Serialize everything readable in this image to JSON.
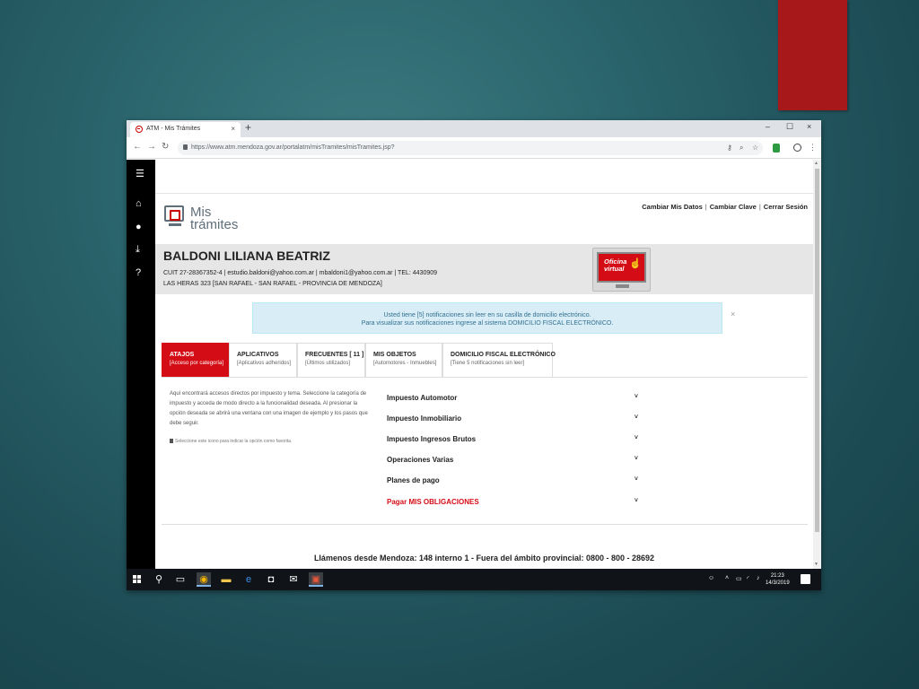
{
  "browser": {
    "tab_title": "ATM - Mis Trámites",
    "tab_close": "×",
    "new_tab": "+",
    "url": "https://www.atm.mendoza.gov.ar/portalatm/misTramites/misTramites.jsp?",
    "controls": {
      "minimize": "–",
      "maximize": "☐",
      "close": "×"
    },
    "nav": {
      "back": "←",
      "forward": "→",
      "reload": "↻"
    }
  },
  "logo": {
    "line1": "Mis",
    "line2": "trámites"
  },
  "top_links": [
    "Cambiar Mis Datos",
    "Cambiar Clave",
    "Cerrar Sesión"
  ],
  "top_links_sep": "|",
  "user": {
    "name": "BALDONI LILIANA BEATRIZ",
    "line1": "CUIT 27-28367352-4 | estudio.baldoni@yahoo.com.ar | mbaldoni1@yahoo.com.ar | TEL: 4430909",
    "line2": "LAS HERAS 323 [SAN RAFAEL - SAN RAFAEL - PROVINCIA DE MENDOZA]"
  },
  "oficina": {
    "line1": "Oficina",
    "line2": "virtual"
  },
  "notice": {
    "line1": "Usted tiene [5] notificaciones sin leer en su casilla de domicilio electrónico.",
    "line2": "Para visualizar sus notificaciones ingrese al sistema DOMICILIO FISCAL ELECTRÓNICO.",
    "close": "×"
  },
  "tabs": [
    {
      "title": "ATAJOS",
      "subtitle": "[Acceso por categoría]"
    },
    {
      "title": "APLICATIVOS",
      "subtitle": "[Aplicativos adheridos]"
    },
    {
      "title": "FRECUENTES [ 11 ]",
      "subtitle": "[Últimos utilizados]"
    },
    {
      "title": "MIS OBJETOS",
      "subtitle": "[Automotores - Inmuebles]"
    },
    {
      "title": "DOMICILIO FISCAL ELECTRÓNICO",
      "subtitle": "[Tiene 5 notificaciones sin leer]"
    }
  ],
  "help_text": "Aquí encontrará accesos directos por impuesto y tema. Seleccione la categoría de impuesto y acceda de modo directo a la funcionalidad deseada. Al presionar la opción deseada se abrirá una ventana con una imagen de ejemplo y los pasos que debe seguir.",
  "favorite_note": "Seleccione este icono para indicar la opción como favorita.",
  "categories": [
    "Impuesto Automotor",
    "Impuesto Inmobiliario",
    "Impuesto Ingresos Brutos",
    "Operaciones Varias",
    "Planes de pago",
    "Pagar MIS OBLIGACIONES"
  ],
  "chevron": "˅",
  "footer": "Llámenos desde Mendoza: 148 interno 1 - Fuera del ámbito provincial: 0800 - 800 - 28692",
  "clock": {
    "time": "21:23",
    "date": "14/3/2019"
  },
  "colors": {
    "accent_red": "#d40c16",
    "slide_accent": "#a7181b",
    "notice_bg": "#d9edf7"
  }
}
